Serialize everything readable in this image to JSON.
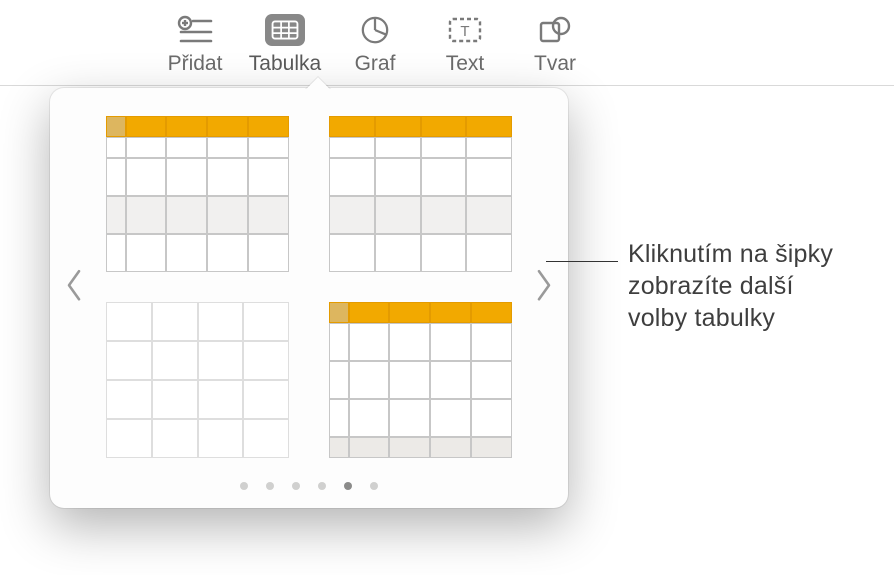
{
  "toolbar": {
    "items": [
      {
        "label": "Přidat"
      },
      {
        "label": "Tabulka"
      },
      {
        "label": "Graf"
      },
      {
        "label": "Text"
      },
      {
        "label": "Tvar"
      }
    ],
    "active_index": 1
  },
  "popover": {
    "page_count": 6,
    "active_page_index": 4
  },
  "callout": {
    "line1": "Kliknutím na šipky",
    "line2": "zobrazíte další",
    "line3": "volby tabulky"
  }
}
